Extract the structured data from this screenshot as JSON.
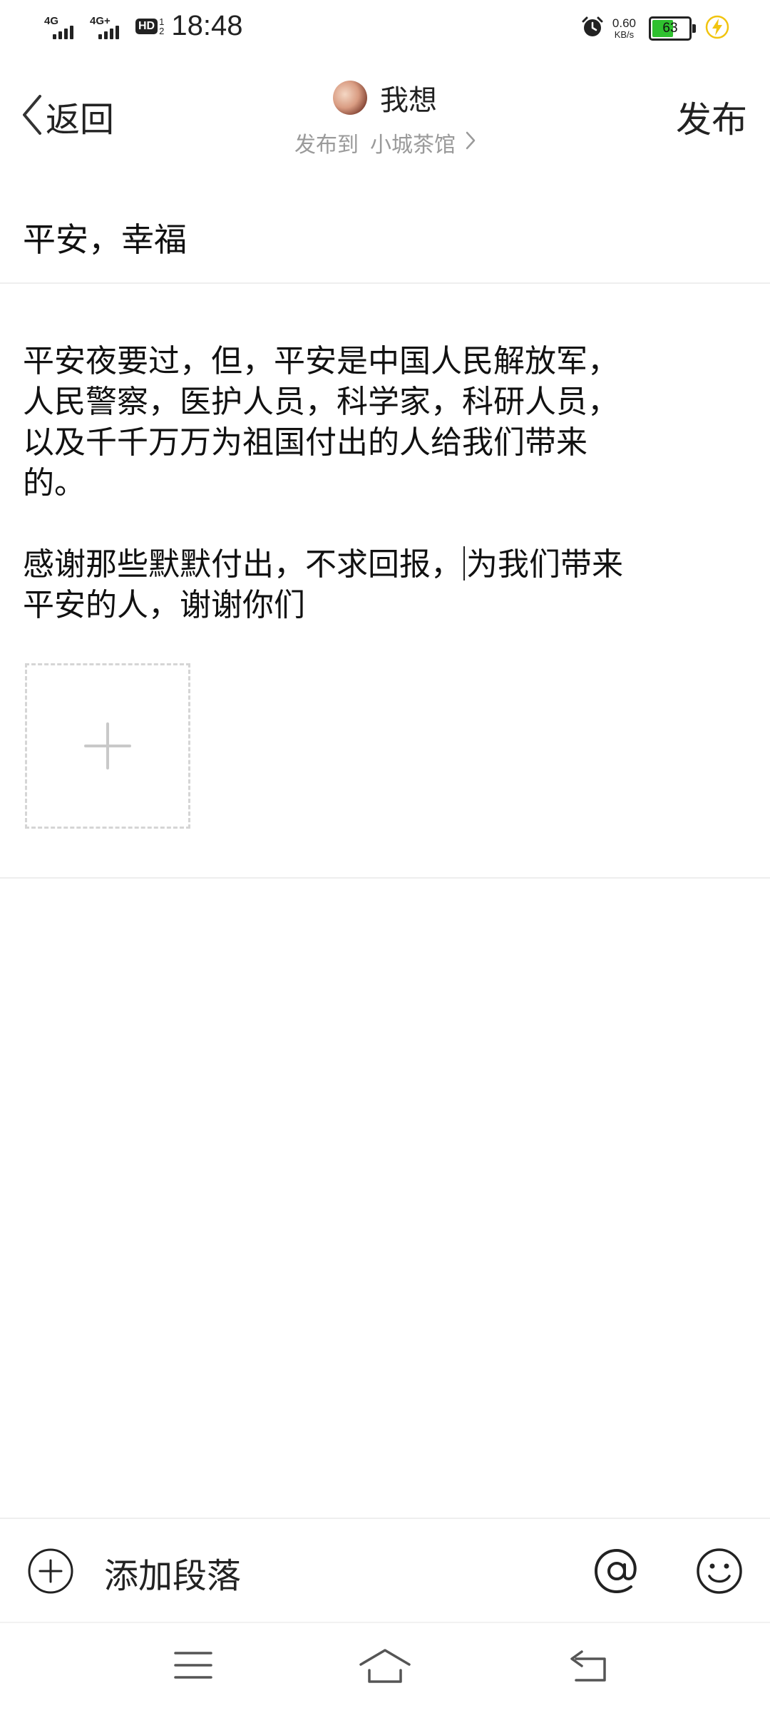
{
  "status_bar": {
    "sim1_label": "4G",
    "sim2_label": "4G+",
    "hd_label": "HD",
    "hd_sub": "1\n2",
    "time": "18:48",
    "net_speed_value": "0.60",
    "net_speed_unit": "KB/s",
    "battery_level": "63",
    "battery_fraction": 0.63,
    "battery_color": "#2fc12f",
    "icons": [
      "signal-icon",
      "signal-icon",
      "hd-voice-icon",
      "alarm-icon",
      "battery-icon",
      "charging-icon"
    ]
  },
  "header": {
    "back_label": "返回",
    "author_name": "我想",
    "publish_to_label": "发布到",
    "group_name": "小城茶馆",
    "publish_button": "发布"
  },
  "editor": {
    "title": "平安，幸福",
    "paragraph1_lines": [
      "平安夜要过，但，平安是中国人民解放军，",
      "人民警察，医护人员，科学家，科研人员，",
      "以及千千万万为祖国付出的人给我们带来",
      "的。"
    ],
    "paragraph2_line1_before_caret": "感谢那些默默付出，不求回报，",
    "paragraph2_line1_after_caret": "为我们带来",
    "paragraph2_line2": "平安的人，谢谢你们"
  },
  "toolbar": {
    "add_paragraph_label": "添加段落",
    "icons": [
      "add-circle-icon",
      "at-icon",
      "emoji-icon"
    ]
  },
  "nav_bar": {
    "icons": [
      "menu-icon",
      "home-icon",
      "back-icon"
    ]
  }
}
